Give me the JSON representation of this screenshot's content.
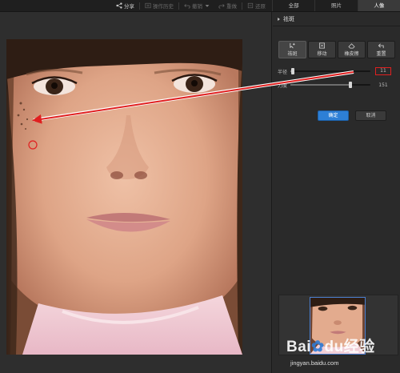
{
  "toolbar": {
    "share_label": "分享",
    "history_label": "操作历史",
    "undo_label": "撤销",
    "redo_label": "重做",
    "restore_label": "还原"
  },
  "tabs": [
    {
      "label": "全部",
      "active": false
    },
    {
      "label": "照片",
      "active": false
    },
    {
      "label": "人像",
      "active": true
    }
  ],
  "panel": {
    "title": "祛斑",
    "tools": [
      {
        "label": "祛斑",
        "icon": "brush-cursor-icon",
        "active": true
      },
      {
        "label": "移动",
        "icon": "move-icon",
        "active": false
      },
      {
        "label": "橡皮擦",
        "icon": "eraser-icon",
        "active": false
      },
      {
        "label": "重置",
        "icon": "reset-icon",
        "active": false
      }
    ],
    "sliders": [
      {
        "label": "半径",
        "value": "11",
        "fraction": 0.03,
        "highlighted": true
      },
      {
        "label": "力度",
        "value": "151",
        "fraction": 0.75,
        "highlighted": false
      }
    ],
    "confirm_label": "确定",
    "cancel_label": "取消"
  },
  "watermark": {
    "brand_prefix": "Bai",
    "brand_middle": "du",
    "brand_suffix": "经验",
    "url": "jingyan.baidu.com"
  },
  "colors": {
    "accent": "#2d7fd6",
    "annotation": "#e02020",
    "background": "#2b2b2b"
  }
}
